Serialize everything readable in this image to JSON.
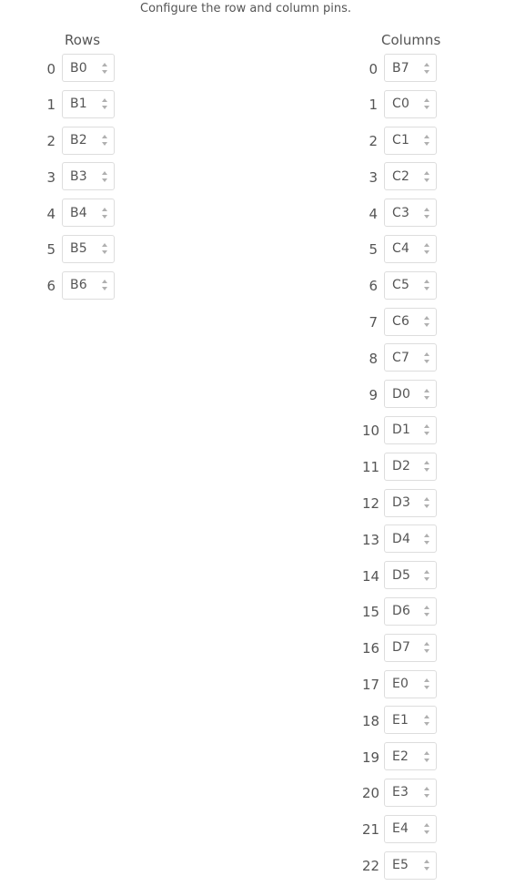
{
  "instructions": "Configure the row and column pins.",
  "rows": {
    "heading": "Rows",
    "pins": [
      {
        "index": "0",
        "value": "B0"
      },
      {
        "index": "1",
        "value": "B1"
      },
      {
        "index": "2",
        "value": "B2"
      },
      {
        "index": "3",
        "value": "B3"
      },
      {
        "index": "4",
        "value": "B4"
      },
      {
        "index": "5",
        "value": "B5"
      },
      {
        "index": "6",
        "value": "B6"
      }
    ]
  },
  "columns": {
    "heading": "Columns",
    "pins": [
      {
        "index": "0",
        "value": "B7"
      },
      {
        "index": "1",
        "value": "C0"
      },
      {
        "index": "2",
        "value": "C1"
      },
      {
        "index": "3",
        "value": "C2"
      },
      {
        "index": "4",
        "value": "C3"
      },
      {
        "index": "5",
        "value": "C4"
      },
      {
        "index": "6",
        "value": "C5"
      },
      {
        "index": "7",
        "value": "C6"
      },
      {
        "index": "8",
        "value": "C7"
      },
      {
        "index": "9",
        "value": "D0"
      },
      {
        "index": "10",
        "value": "D1"
      },
      {
        "index": "11",
        "value": "D2"
      },
      {
        "index": "12",
        "value": "D3"
      },
      {
        "index": "13",
        "value": "D4"
      },
      {
        "index": "14",
        "value": "D5"
      },
      {
        "index": "15",
        "value": "D6"
      },
      {
        "index": "16",
        "value": "D7"
      },
      {
        "index": "17",
        "value": "E0"
      },
      {
        "index": "18",
        "value": "E1"
      },
      {
        "index": "19",
        "value": "E2"
      },
      {
        "index": "20",
        "value": "E3"
      },
      {
        "index": "21",
        "value": "E4"
      },
      {
        "index": "22",
        "value": "E5"
      }
    ]
  }
}
